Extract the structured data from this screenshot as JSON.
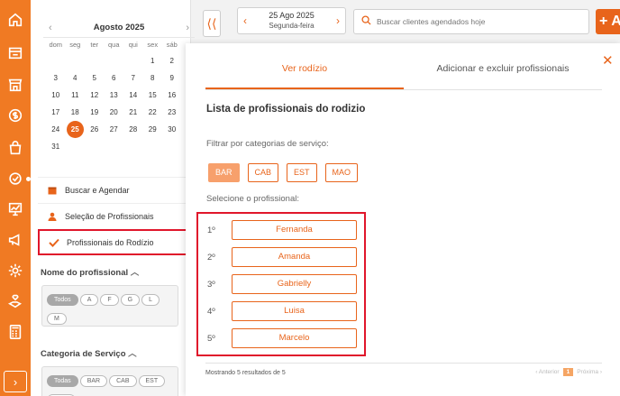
{
  "rail": {
    "icons": [
      "home-icon",
      "store-icon",
      "shop-icon",
      "money-icon",
      "bag-icon",
      "settings-check-icon",
      "chart-icon",
      "megaphone-icon",
      "gear-icon",
      "hand-heart-icon",
      "calculator-icon",
      "chevron-right-icon"
    ]
  },
  "calendar": {
    "month_label": "Agosto 2025",
    "prev": "‹",
    "next": "›",
    "weekdays": [
      "dom",
      "seg",
      "ter",
      "qua",
      "qui",
      "sex",
      "sáb"
    ],
    "days": [
      "",
      "",
      "",
      "",
      "",
      "1",
      "2",
      "3",
      "4",
      "5",
      "6",
      "7",
      "8",
      "9",
      "10",
      "11",
      "12",
      "13",
      "14",
      "15",
      "16",
      "17",
      "18",
      "19",
      "20",
      "21",
      "22",
      "23",
      "24",
      "25",
      "26",
      "27",
      "28",
      "29",
      "30",
      "31"
    ],
    "selected_day": "25"
  },
  "menu": {
    "items": [
      {
        "label": "Buscar e Agendar",
        "icon": "calendar-icon"
      },
      {
        "label": "Seleção de Profissionais",
        "icon": "person-icon"
      },
      {
        "label": "Profissionais do Rodízio",
        "icon": "check-icon"
      }
    ]
  },
  "filters": {
    "prof_title": "Nome do profissional",
    "prof_chips": [
      "Todos",
      "A",
      "F",
      "G",
      "L",
      "M"
    ],
    "cat_title": "Categoria de Serviço",
    "cat_chips": [
      "Todas",
      "BAR",
      "CAB",
      "EST",
      "MAO"
    ]
  },
  "topbar": {
    "collapse": "⟨⟨",
    "date_line1": "25 Ago 2025",
    "date_line2": "Segunda-feira",
    "search_placeholder": "Buscar clientes agendados hoje",
    "add_label": "+ A"
  },
  "modal": {
    "tabs": [
      "Ver rodízio",
      "Adicionar e excluir profissionais"
    ],
    "close": "✕",
    "title": "Lista de profissionais do rodizio",
    "filter_label": "Filtrar por categorias de serviço:",
    "categories": [
      "BAR",
      "CAB",
      "EST",
      "MAO"
    ],
    "active_category": "BAR",
    "select_label": "Selecione o profissional:",
    "professionals": [
      {
        "order": "1º",
        "name": "Fernanda"
      },
      {
        "order": "2º",
        "name": "Amanda"
      },
      {
        "order": "3º",
        "name": "Gabrielly"
      },
      {
        "order": "4º",
        "name": "Luisa"
      },
      {
        "order": "5º",
        "name": "Marcelo"
      }
    ],
    "results_text": "Mostrando 5 resultados de 5",
    "pager": {
      "prev": "‹ Anterior",
      "current": "1",
      "next": "Próxima ›"
    }
  },
  "colors": {
    "accent": "#e8641b",
    "highlight": "#e0162b"
  }
}
